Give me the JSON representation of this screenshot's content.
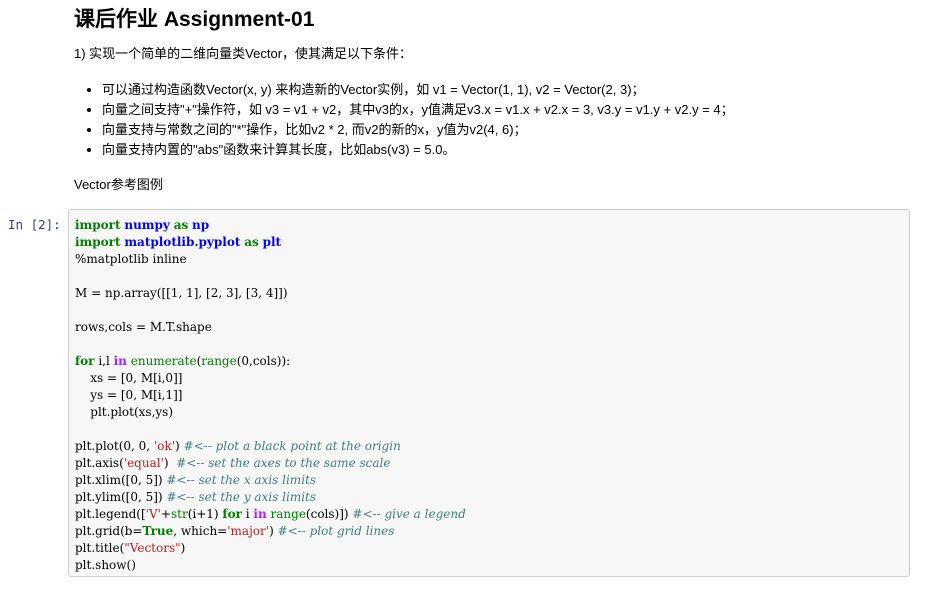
{
  "markdown": {
    "title": "课后作业 Assignment-01",
    "intro": "1) 实现一个简单的二维向量类Vector，使其满足以下条件：",
    "bullets": [
      "可以通过构造函数Vector(x, y) 来构造新的Vector实例，如 v1 = Vector(1, 1), v2 = Vector(2, 3)；",
      "向量之间支持\"+\"操作符，如 v3 = v1 + v2，其中v3的x，y值满足v3.x = v1.x + v2.x = 3, v3.y = v1.y + v2.y = 4；",
      "向量支持与常数之间的\"*\"操作，比如v2 * 2, 而v2的新的x，y值为v2(4, 6)；",
      "向量支持内置的\"abs\"函数来计算其长度，比如abs(v3) = 5.0。"
    ],
    "reference": "Vector参考图例"
  },
  "cell": {
    "prompt": "In  [2]:",
    "code_lines": [
      "import numpy as np",
      "import matplotlib.pyplot as plt",
      "%matplotlib inline",
      "",
      "M = np.array([[1, 1], [2, 3], [3, 4]])",
      "",
      "rows,cols = M.T.shape",
      "",
      "for i,l in enumerate(range(0,cols)):",
      "    xs = [0, M[i,0]]",
      "    ys = [0, M[i,1]]",
      "    plt.plot(xs,ys)",
      "",
      "plt.plot(0, 0, 'ok') #<-- plot a black point at the origin",
      "plt.axis('equal')  #<-- set the axes to the same scale",
      "plt.xlim([0, 5]) #<-- set the x axis limits",
      "plt.ylim([0, 5]) #<-- set the y axis limits",
      "plt.legend(['V'+str(i+1) for i in range(cols)]) #<-- give a legend",
      "plt.grid(b=True, which='major') #<-- plot grid lines",
      "plt.title(\"Vectors\")",
      "plt.show()"
    ]
  },
  "colors": {
    "keyword": "#008000",
    "module": "#0000ff",
    "string": "#ba2121",
    "comment": "#408080",
    "operator_word": "#aa22ff",
    "prompt": "#303f9f",
    "cell_bg": "#f7f7f7",
    "cell_border": "#cfcfcf"
  }
}
